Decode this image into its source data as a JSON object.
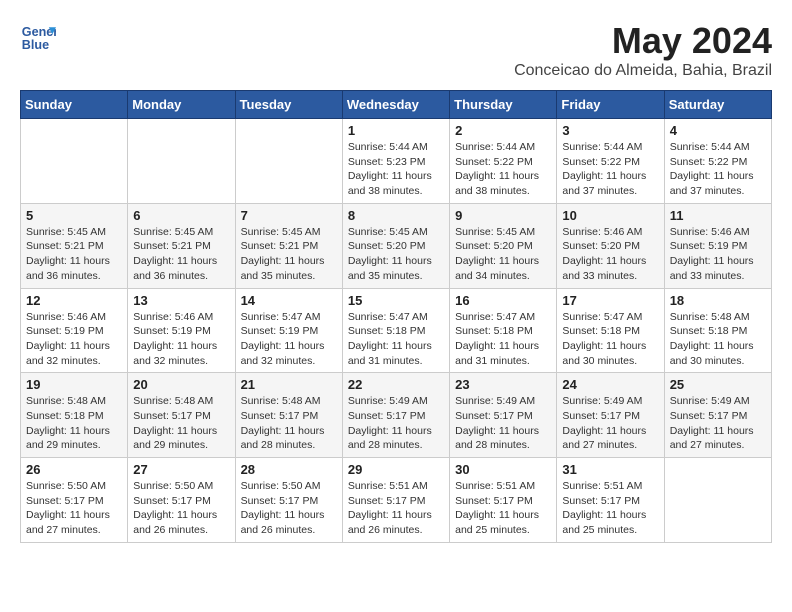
{
  "header": {
    "logo_line1": "General",
    "logo_line2": "Blue",
    "title": "May 2024",
    "subtitle": "Conceicao do Almeida, Bahia, Brazil"
  },
  "weekdays": [
    "Sunday",
    "Monday",
    "Tuesday",
    "Wednesday",
    "Thursday",
    "Friday",
    "Saturday"
  ],
  "weeks": [
    [
      {
        "day": "",
        "info": ""
      },
      {
        "day": "",
        "info": ""
      },
      {
        "day": "",
        "info": ""
      },
      {
        "day": "1",
        "info": "Sunrise: 5:44 AM\nSunset: 5:23 PM\nDaylight: 11 hours\nand 38 minutes."
      },
      {
        "day": "2",
        "info": "Sunrise: 5:44 AM\nSunset: 5:22 PM\nDaylight: 11 hours\nand 38 minutes."
      },
      {
        "day": "3",
        "info": "Sunrise: 5:44 AM\nSunset: 5:22 PM\nDaylight: 11 hours\nand 37 minutes."
      },
      {
        "day": "4",
        "info": "Sunrise: 5:44 AM\nSunset: 5:22 PM\nDaylight: 11 hours\nand 37 minutes."
      }
    ],
    [
      {
        "day": "5",
        "info": "Sunrise: 5:45 AM\nSunset: 5:21 PM\nDaylight: 11 hours\nand 36 minutes."
      },
      {
        "day": "6",
        "info": "Sunrise: 5:45 AM\nSunset: 5:21 PM\nDaylight: 11 hours\nand 36 minutes."
      },
      {
        "day": "7",
        "info": "Sunrise: 5:45 AM\nSunset: 5:21 PM\nDaylight: 11 hours\nand 35 minutes."
      },
      {
        "day": "8",
        "info": "Sunrise: 5:45 AM\nSunset: 5:20 PM\nDaylight: 11 hours\nand 35 minutes."
      },
      {
        "day": "9",
        "info": "Sunrise: 5:45 AM\nSunset: 5:20 PM\nDaylight: 11 hours\nand 34 minutes."
      },
      {
        "day": "10",
        "info": "Sunrise: 5:46 AM\nSunset: 5:20 PM\nDaylight: 11 hours\nand 33 minutes."
      },
      {
        "day": "11",
        "info": "Sunrise: 5:46 AM\nSunset: 5:19 PM\nDaylight: 11 hours\nand 33 minutes."
      }
    ],
    [
      {
        "day": "12",
        "info": "Sunrise: 5:46 AM\nSunset: 5:19 PM\nDaylight: 11 hours\nand 32 minutes."
      },
      {
        "day": "13",
        "info": "Sunrise: 5:46 AM\nSunset: 5:19 PM\nDaylight: 11 hours\nand 32 minutes."
      },
      {
        "day": "14",
        "info": "Sunrise: 5:47 AM\nSunset: 5:19 PM\nDaylight: 11 hours\nand 32 minutes."
      },
      {
        "day": "15",
        "info": "Sunrise: 5:47 AM\nSunset: 5:18 PM\nDaylight: 11 hours\nand 31 minutes."
      },
      {
        "day": "16",
        "info": "Sunrise: 5:47 AM\nSunset: 5:18 PM\nDaylight: 11 hours\nand 31 minutes."
      },
      {
        "day": "17",
        "info": "Sunrise: 5:47 AM\nSunset: 5:18 PM\nDaylight: 11 hours\nand 30 minutes."
      },
      {
        "day": "18",
        "info": "Sunrise: 5:48 AM\nSunset: 5:18 PM\nDaylight: 11 hours\nand 30 minutes."
      }
    ],
    [
      {
        "day": "19",
        "info": "Sunrise: 5:48 AM\nSunset: 5:18 PM\nDaylight: 11 hours\nand 29 minutes."
      },
      {
        "day": "20",
        "info": "Sunrise: 5:48 AM\nSunset: 5:17 PM\nDaylight: 11 hours\nand 29 minutes."
      },
      {
        "day": "21",
        "info": "Sunrise: 5:48 AM\nSunset: 5:17 PM\nDaylight: 11 hours\nand 28 minutes."
      },
      {
        "day": "22",
        "info": "Sunrise: 5:49 AM\nSunset: 5:17 PM\nDaylight: 11 hours\nand 28 minutes."
      },
      {
        "day": "23",
        "info": "Sunrise: 5:49 AM\nSunset: 5:17 PM\nDaylight: 11 hours\nand 28 minutes."
      },
      {
        "day": "24",
        "info": "Sunrise: 5:49 AM\nSunset: 5:17 PM\nDaylight: 11 hours\nand 27 minutes."
      },
      {
        "day": "25",
        "info": "Sunrise: 5:49 AM\nSunset: 5:17 PM\nDaylight: 11 hours\nand 27 minutes."
      }
    ],
    [
      {
        "day": "26",
        "info": "Sunrise: 5:50 AM\nSunset: 5:17 PM\nDaylight: 11 hours\nand 27 minutes."
      },
      {
        "day": "27",
        "info": "Sunrise: 5:50 AM\nSunset: 5:17 PM\nDaylight: 11 hours\nand 26 minutes."
      },
      {
        "day": "28",
        "info": "Sunrise: 5:50 AM\nSunset: 5:17 PM\nDaylight: 11 hours\nand 26 minutes."
      },
      {
        "day": "29",
        "info": "Sunrise: 5:51 AM\nSunset: 5:17 PM\nDaylight: 11 hours\nand 26 minutes."
      },
      {
        "day": "30",
        "info": "Sunrise: 5:51 AM\nSunset: 5:17 PM\nDaylight: 11 hours\nand 25 minutes."
      },
      {
        "day": "31",
        "info": "Sunrise: 5:51 AM\nSunset: 5:17 PM\nDaylight: 11 hours\nand 25 minutes."
      },
      {
        "day": "",
        "info": ""
      }
    ]
  ]
}
